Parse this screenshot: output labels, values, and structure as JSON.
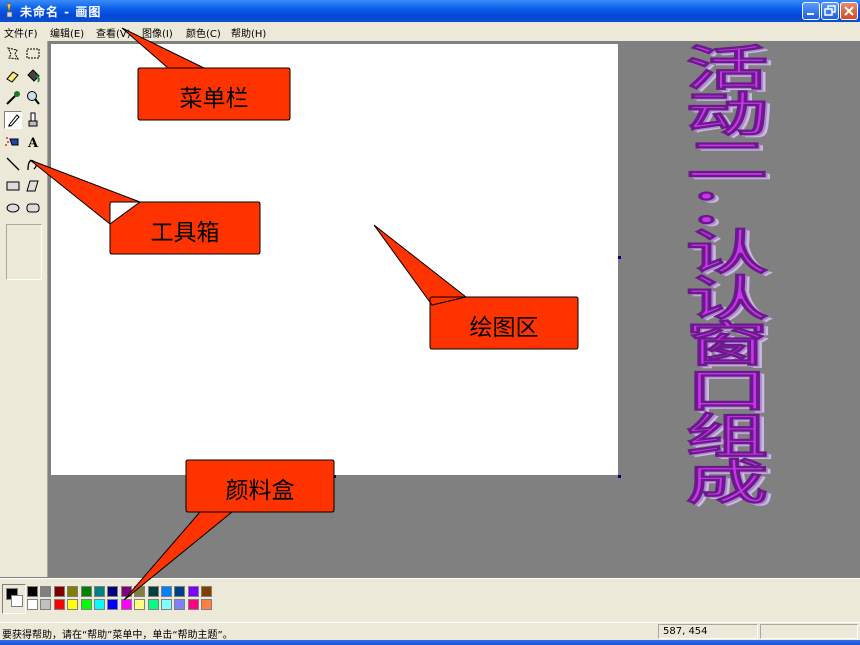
{
  "window": {
    "title": "未命名 - 画图",
    "controls": [
      "minimize-icon",
      "maximize-icon",
      "close-icon"
    ]
  },
  "menubar": {
    "items": [
      {
        "label": "文件(F)"
      },
      {
        "label": "编辑(E)"
      },
      {
        "label": "查看(V)"
      },
      {
        "label": "图像(I)"
      },
      {
        "label": "颜色(C)"
      },
      {
        "label": "帮助(H)"
      }
    ]
  },
  "toolbox": {
    "tools": [
      {
        "icon": "free-select-icon"
      },
      {
        "icon": "rect-select-icon"
      },
      {
        "icon": "eraser-icon"
      },
      {
        "icon": "fill-bucket-icon"
      },
      {
        "icon": "color-picker-icon"
      },
      {
        "icon": "magnifier-icon"
      },
      {
        "icon": "pencil-icon",
        "selected": true
      },
      {
        "icon": "brush-icon"
      },
      {
        "icon": "airbrush-icon"
      },
      {
        "icon": "text-icon",
        "label": "A"
      },
      {
        "icon": "line-icon"
      },
      {
        "icon": "curve-icon"
      },
      {
        "icon": "rectangle-icon"
      },
      {
        "icon": "polygon-icon"
      },
      {
        "icon": "ellipse-icon"
      },
      {
        "icon": "rounded-rect-icon"
      }
    ]
  },
  "palette": {
    "foreground": "#000000",
    "background": "#ffffff",
    "top_row": [
      "#000000",
      "#808080",
      "#800000",
      "#808000",
      "#008000",
      "#008080",
      "#000080",
      "#800080",
      "#808040",
      "#004040",
      "#0080ff",
      "#004080",
      "#8000ff",
      "#804000"
    ],
    "bottom_row": [
      "#ffffff",
      "#c0c0c0",
      "#ff0000",
      "#ffff00",
      "#00ff00",
      "#00ffff",
      "#0000ff",
      "#ff00ff",
      "#ffff80",
      "#00ff80",
      "#80ffff",
      "#8080ff",
      "#ff0080",
      "#ff8040"
    ]
  },
  "statusbar": {
    "help_text": "要获得帮助，请在“帮助”菜单中，单击“帮助主题”。",
    "coordinates": "587, 454"
  },
  "callouts": {
    "menubar": "菜单栏",
    "toolbox": "工具箱",
    "canvas": "绘图区",
    "palette": "颜料盒"
  },
  "slide_title": "活动二：认认窗口组成",
  "colors": {
    "callout_fill": "#ff3300",
    "title_bar": "#0a5ee8",
    "title_text": "#cc33ee"
  }
}
